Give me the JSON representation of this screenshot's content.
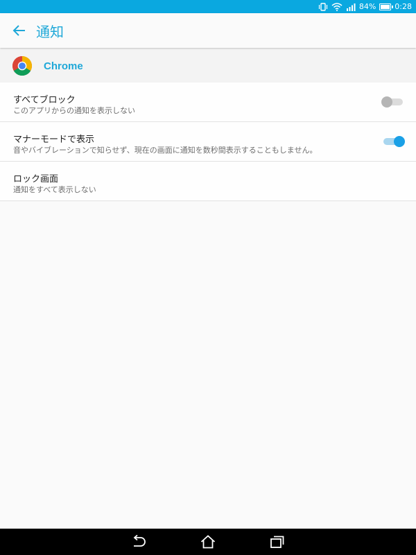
{
  "status_bar": {
    "battery": "84%",
    "time": "0:28"
  },
  "app_bar": {
    "title": "通知"
  },
  "app": {
    "name": "Chrome",
    "icon": "chrome-logo"
  },
  "settings": [
    {
      "title": "すべてブロック",
      "description": "このアプリからの通知を表示しない",
      "toggle": "off"
    },
    {
      "title": "マナーモードで表示",
      "description": "音やバイブレーションで知らせず、現在の画面に通知を数秒間表示することもしません。",
      "toggle": "on"
    },
    {
      "title": "ロック画面",
      "description": "通知をすべて表示しない"
    }
  ],
  "colors": {
    "accent": "#1fa8d8",
    "status_bar": "#0aa8e0",
    "toggle_on": "#1aa0e6"
  }
}
